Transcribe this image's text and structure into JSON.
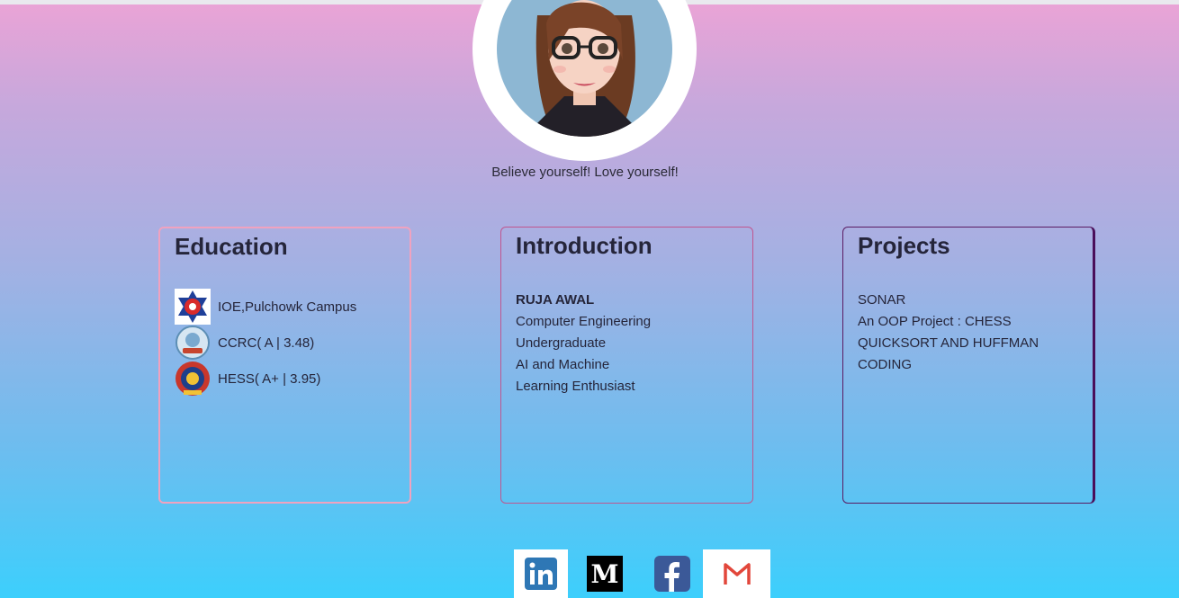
{
  "profile": {
    "tagline": "Believe yourself! Love yourself!",
    "avatar_icon": "girl-with-glasses-avatar"
  },
  "education": {
    "title": "Education",
    "items": [
      {
        "label": "IOE,Pulchowk Campus",
        "icon": "tu-star-logo-icon"
      },
      {
        "label": "CCRC( A | 3.48)",
        "icon": "ccrc-logo-icon"
      },
      {
        "label": "HESS( A+ | 3.95)",
        "icon": "hess-logo-icon"
      }
    ]
  },
  "introduction": {
    "title": "Introduction",
    "name": "RUJA AWAL",
    "lines": [
      "Computer Engineering",
      "Undergraduate",
      "AI and Machine",
      "Learning Enthusiast"
    ]
  },
  "projects": {
    "title": "Projects",
    "lines": [
      "SONAR",
      "An OOP Project : CHESS",
      "QUICKSORT AND HUFFMAN",
      "CODING"
    ]
  },
  "social": [
    {
      "icon": "linkedin-icon",
      "color": "#2e77b5"
    },
    {
      "icon": "medium-icon",
      "color": "#000000"
    },
    {
      "icon": "facebook-icon",
      "color": "#3b5998"
    },
    {
      "icon": "gmail-icon",
      "color": "#e2473b"
    }
  ]
}
